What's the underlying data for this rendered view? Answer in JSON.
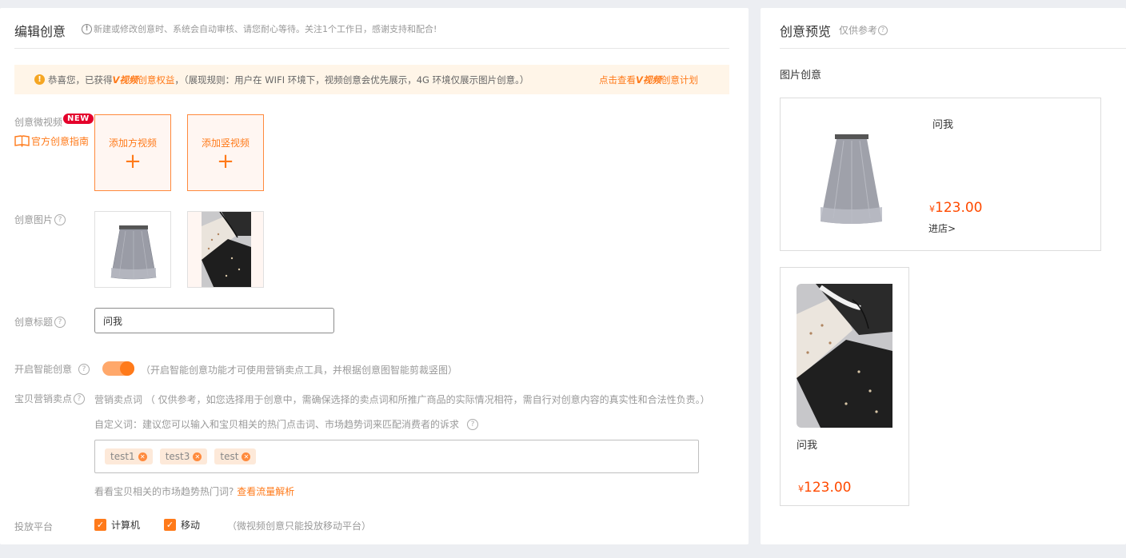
{
  "editor": {
    "title": "编辑创意",
    "note": "新建或修改创意时、系统会自动审核、请您耐心等待。关注1个工作日，感谢支持和配合!",
    "notice": {
      "prefix": "恭喜您，已获得",
      "brand": "V视频",
      "suffix_orange": "创意权益",
      "suffix": "，（展现规则：用户在 WIFI 环境下，视频创意会优先展示，4G 环境仅展示图片创意。）",
      "link_prefix": "点击查看",
      "link_brand": "V视频",
      "link_suffix": "创意计划"
    },
    "video": {
      "label": "创意微视频",
      "badge": "NEW",
      "guide": "官方创意指南",
      "add_square": "添加方视频",
      "add_vertical": "添加竖视频",
      "plus": "+"
    },
    "images": {
      "label": "创意图片"
    },
    "creative_title": {
      "label": "创意标题",
      "value": "问我"
    },
    "smart": {
      "label": "开启智能创意",
      "enabled": true,
      "note": "（开启智能创意功能才可使用营销卖点工具，并根据创意图智能剪裁竖图）"
    },
    "selling": {
      "label": "宝贝营销卖点",
      "line1": "营销卖点词 （ 仅供参考，如您选择用于创意中，需确保选择的卖点词和所推广商品的实际情况相符，需自行对创意内容的真实性和合法性负责。）",
      "line2": "自定义词：建议您可以输入和宝贝相关的热门点击词、市场趋势词来匹配消费者的诉求",
      "tags": [
        "test1",
        "test3",
        "test"
      ],
      "hint": "看看宝贝相关的市场趋势热门词?",
      "hint_link": "查看流量解析"
    },
    "platform": {
      "label": "投放平台",
      "options": [
        "计算机",
        "移动"
      ],
      "note": "（微视频创意只能投放移动平台）"
    }
  },
  "preview": {
    "title": "创意预览",
    "sub": "仅供参考",
    "section": "图片创意",
    "card1": {
      "name": "问我",
      "currency": "¥",
      "price": "123.00",
      "link": "进店>"
    },
    "card2": {
      "name": "问我",
      "currency": "¥",
      "price": "123.00"
    }
  },
  "colors": {
    "accent": "#ff7a1a",
    "price": "#ff4a00",
    "badge": "#e4002b",
    "notice_bg": "#fff5e8"
  }
}
